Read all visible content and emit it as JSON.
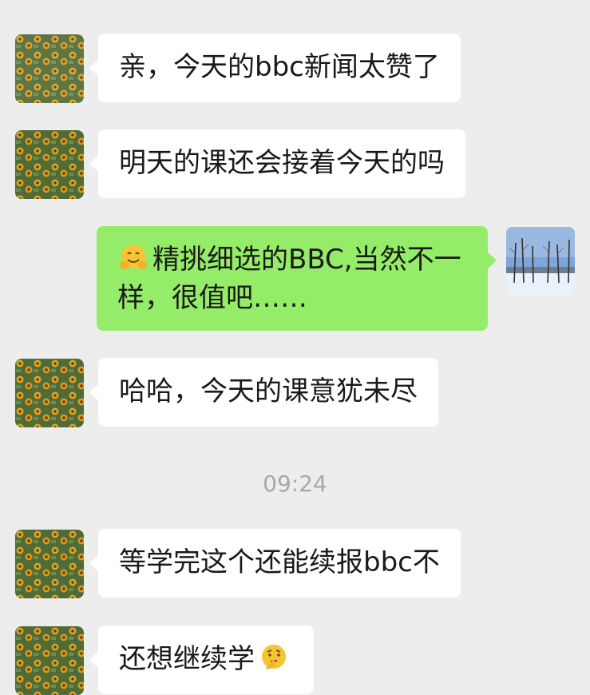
{
  "chat": {
    "messages": [
      {
        "sender": "other",
        "avatar": "sunflower-field-avatar",
        "text": "亲，今天的bbc新闻太赞了"
      },
      {
        "sender": "other",
        "avatar": "sunflower-field-avatar",
        "text": "明天的课还会接着今天的吗"
      },
      {
        "sender": "self",
        "avatar": "snowy-trees-avatar",
        "emoji": "hugging-face-emoji",
        "text": "精挑细选的BBC,当然不一样，很值吧……"
      },
      {
        "sender": "other",
        "avatar": "sunflower-field-avatar",
        "text": "哈哈，今天的课意犹未尽"
      },
      {
        "sender": "other",
        "avatar": "sunflower-field-avatar",
        "text": "等学完这个还能续报bbc不"
      },
      {
        "sender": "other",
        "avatar": "sunflower-field-avatar",
        "text": "还想继续学",
        "emoji": "thinking-face-emoji"
      }
    ],
    "timestamp": "09:24"
  },
  "colors": {
    "background": "#ededed",
    "incoming_bubble": "#ffffff",
    "outgoing_bubble": "#95ec69",
    "timestamp_text": "#a8a8a8"
  }
}
